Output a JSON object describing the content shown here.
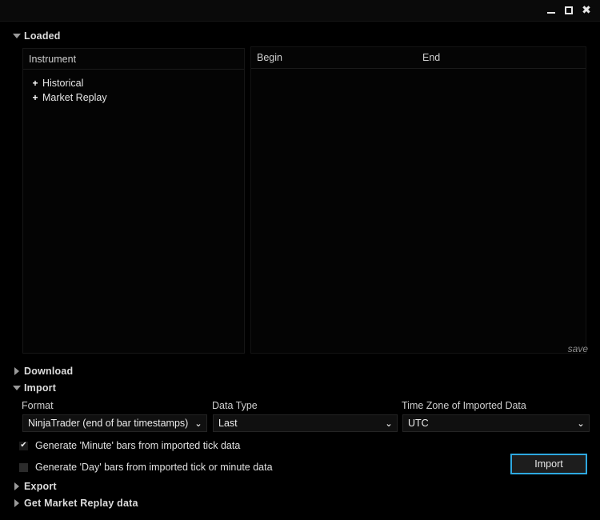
{
  "window": {
    "minimize_label": "—",
    "maximize_label": "",
    "close_label": "✖"
  },
  "sections": {
    "loaded": {
      "label": "Loaded",
      "expanded": true
    },
    "download": {
      "label": "Download",
      "expanded": false
    },
    "import": {
      "label": "Import",
      "expanded": true
    },
    "export": {
      "label": "Export",
      "expanded": false
    },
    "market_replay": {
      "label": "Get Market Replay data",
      "expanded": false
    }
  },
  "loaded_panel": {
    "instrument_column_header": "Instrument",
    "tree_items": [
      {
        "label": "Historical",
        "expander": "+"
      },
      {
        "label": "Market Replay",
        "expander": "+"
      }
    ],
    "grid_columns": [
      "Begin",
      "End"
    ],
    "grid_rows": [],
    "save_label": "save"
  },
  "import_panel": {
    "format": {
      "label": "Format",
      "value": "NinjaTrader (end of bar timestamps)",
      "chevron": "⌄"
    },
    "data_type": {
      "label": "Data Type",
      "value": "Last",
      "chevron": "⌄"
    },
    "time_zone": {
      "label": "Time Zone of Imported Data",
      "value": "UTC",
      "chevron": "⌄"
    },
    "generate_minute": {
      "label": "Generate 'Minute' bars from imported tick data",
      "checked": true,
      "tick": "✔"
    },
    "generate_day": {
      "label": "Generate 'Day' bars from imported tick or minute data",
      "checked": false,
      "tick": ""
    },
    "import_button_label": "Import"
  },
  "colors": {
    "background": "#000000",
    "panel": "#040404",
    "text": "#e0e0e0",
    "accent": "#2ea8e0",
    "muted": "#8d8d8d"
  }
}
